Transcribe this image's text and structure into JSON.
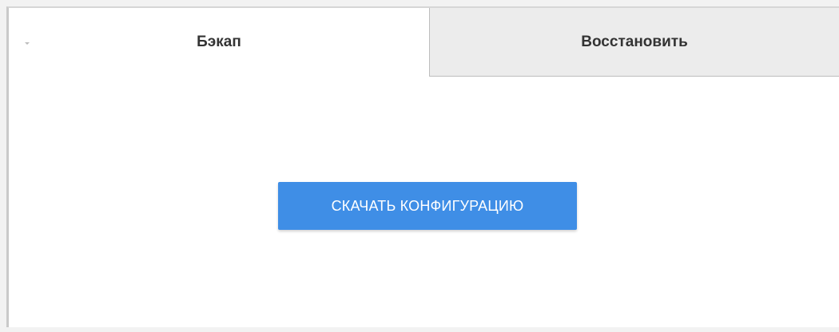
{
  "tabs": {
    "backup_label": "Бэкап",
    "restore_label": "Восстановить",
    "active": "backup",
    "collapse_icon": "chevron-down-icon"
  },
  "backup": {
    "download_button_label": "СКАЧАТЬ КОНФИГУРАЦИЮ"
  },
  "colors": {
    "accent": "#3f8ee6",
    "inactive_tab": "#ececec"
  }
}
